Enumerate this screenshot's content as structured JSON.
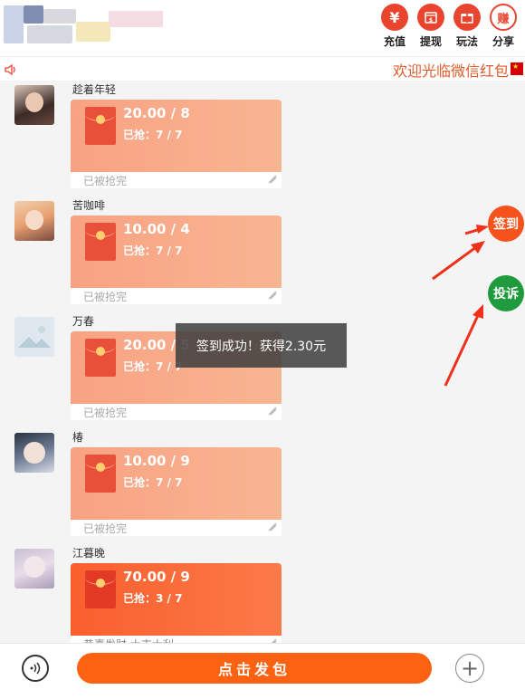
{
  "header": {
    "actions": [
      {
        "label": "充值",
        "icon": "yen-icon",
        "glyph": "¥",
        "color": "#e8442e"
      },
      {
        "label": "提现",
        "icon": "wallet-icon",
        "glyph": "▤",
        "color": "#e8442e"
      },
      {
        "label": "玩法",
        "icon": "gift-icon",
        "glyph": "⊞",
        "color": "#e8442e"
      },
      {
        "label": "分享",
        "icon": "earn-icon",
        "glyph": "赚",
        "color": "#e8442e"
      }
    ]
  },
  "marquee": {
    "text": "欢迎光临微信红包",
    "icon": "speaker-icon"
  },
  "messages": [
    {
      "username": "趁着年轻",
      "amount": "20.00 / 8",
      "grabbed": "已抢：7 / 7",
      "footer": "已被抢完",
      "state": "finished"
    },
    {
      "username": "苦咖啡",
      "amount": "10.00 / 4",
      "grabbed": "已抢：7 / 7",
      "footer": "已被抢完",
      "state": "finished"
    },
    {
      "username": "万春",
      "amount": "20.00 / 5",
      "grabbed": "已抢：7 / 7",
      "footer": "已被抢完",
      "state": "finished"
    },
    {
      "username": "椿",
      "amount": "10.00 / 9",
      "grabbed": "已抢：7 / 7",
      "footer": "已被抢完",
      "state": "finished"
    },
    {
      "username": "江暮晚",
      "amount": "70.00 / 9",
      "grabbed": "已抢：3 / 7",
      "footer": "恭喜发财,大吉大利",
      "state": "active"
    }
  ],
  "toast": {
    "text": "签到成功！获得2.30元"
  },
  "side_buttons": {
    "checkin": {
      "label": "签到",
      "color": "#f5531b"
    },
    "complaint": {
      "label": "投诉",
      "color": "#1f9a3c"
    }
  },
  "footer": {
    "send_label": "点击发包",
    "plus_glyph": "+"
  },
  "colors": {
    "packet_finished": "#f7a888",
    "packet_active": "#fb6a3a",
    "send_button": "#fd6212"
  }
}
